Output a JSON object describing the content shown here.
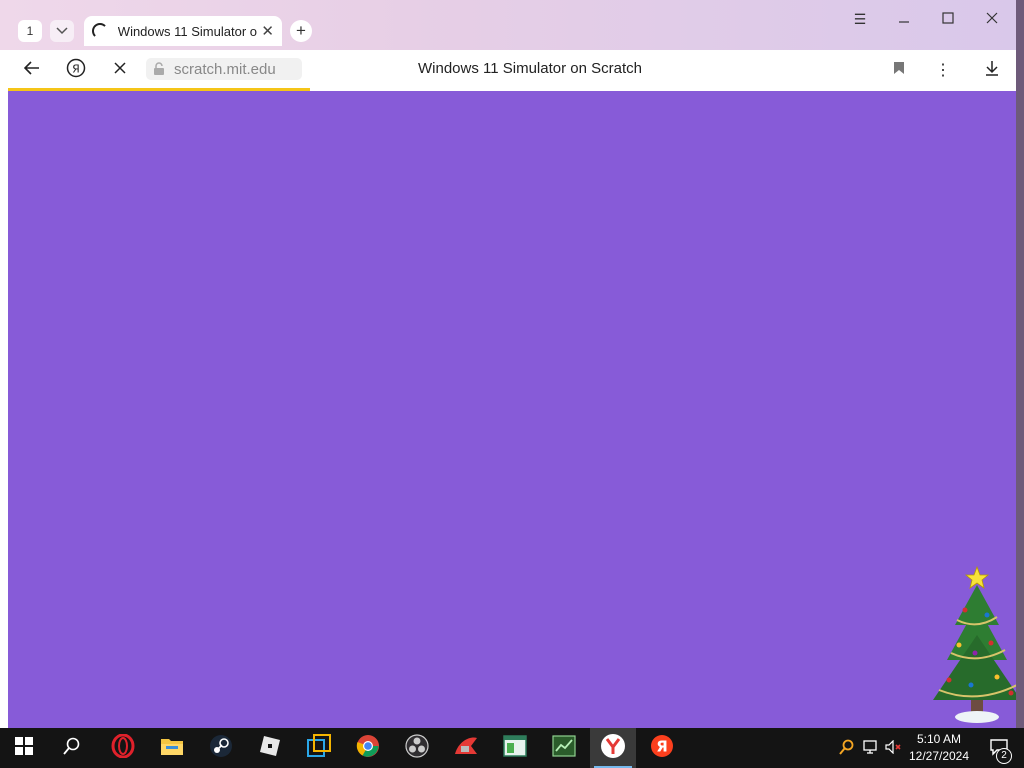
{
  "browser": {
    "tab_count": "1",
    "tab": {
      "title": "Windows 11 Simulator on Scratch"
    },
    "window_controls": [
      "menu",
      "minimize",
      "maximize",
      "close"
    ],
    "address": {
      "url": "scratch.mit.edu",
      "page_title": "Windows 11 Simulator on Scratch"
    },
    "load_progress": 0.3
  },
  "page": {
    "background": "#875bd8"
  },
  "taskbar": {
    "apps": [
      "start",
      "search",
      "opera",
      "file-explorer",
      "steam",
      "roblox",
      "app-blue",
      "chrome",
      "obs",
      "app-red",
      "app-window",
      "app-green",
      "yandex-browser",
      "yandex"
    ],
    "active_app": "yandex-browser",
    "clock": {
      "time": "5:10 AM",
      "date": "12/27/2024"
    },
    "notification_count": "2"
  },
  "colors": {
    "accent_progress": "#f5c518",
    "taskbar": "#141414",
    "tab_gradient": "#e7cfe6"
  }
}
